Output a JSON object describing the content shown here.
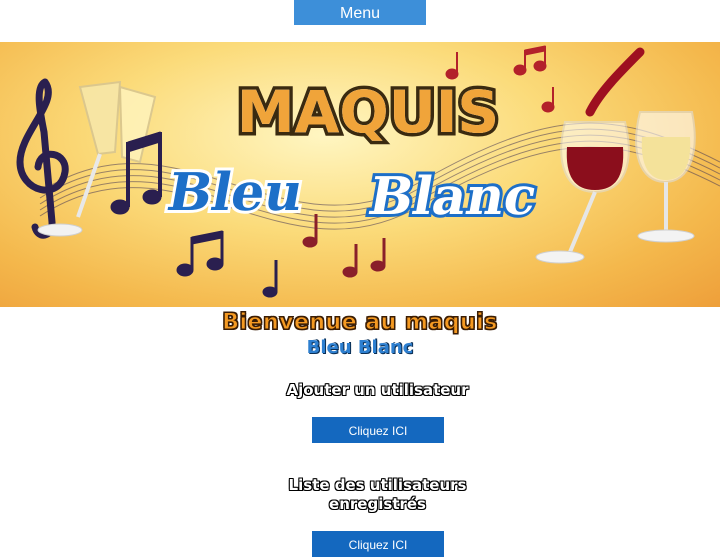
{
  "header": {
    "menu_label": "Menu"
  },
  "banner": {
    "title_top": "MAQUIS",
    "title_left": "Bleu",
    "title_right": "Blanc"
  },
  "welcome": {
    "line1": "Bienvenue au maquis",
    "line2": "Bleu Blanc"
  },
  "actions": [
    {
      "label": "Ajouter un utilisateur",
      "button": "Cliquez ICI"
    },
    {
      "label_line1": "Liste des utilisateurs",
      "label_line2": "enregistrés",
      "button": "Cliquez ICI"
    }
  ],
  "colors": {
    "menu_button": "#3d8fd9",
    "action_button": "#1468bf",
    "welcome_orange": "#f59a22",
    "welcome_blue": "#2d7fd0"
  }
}
